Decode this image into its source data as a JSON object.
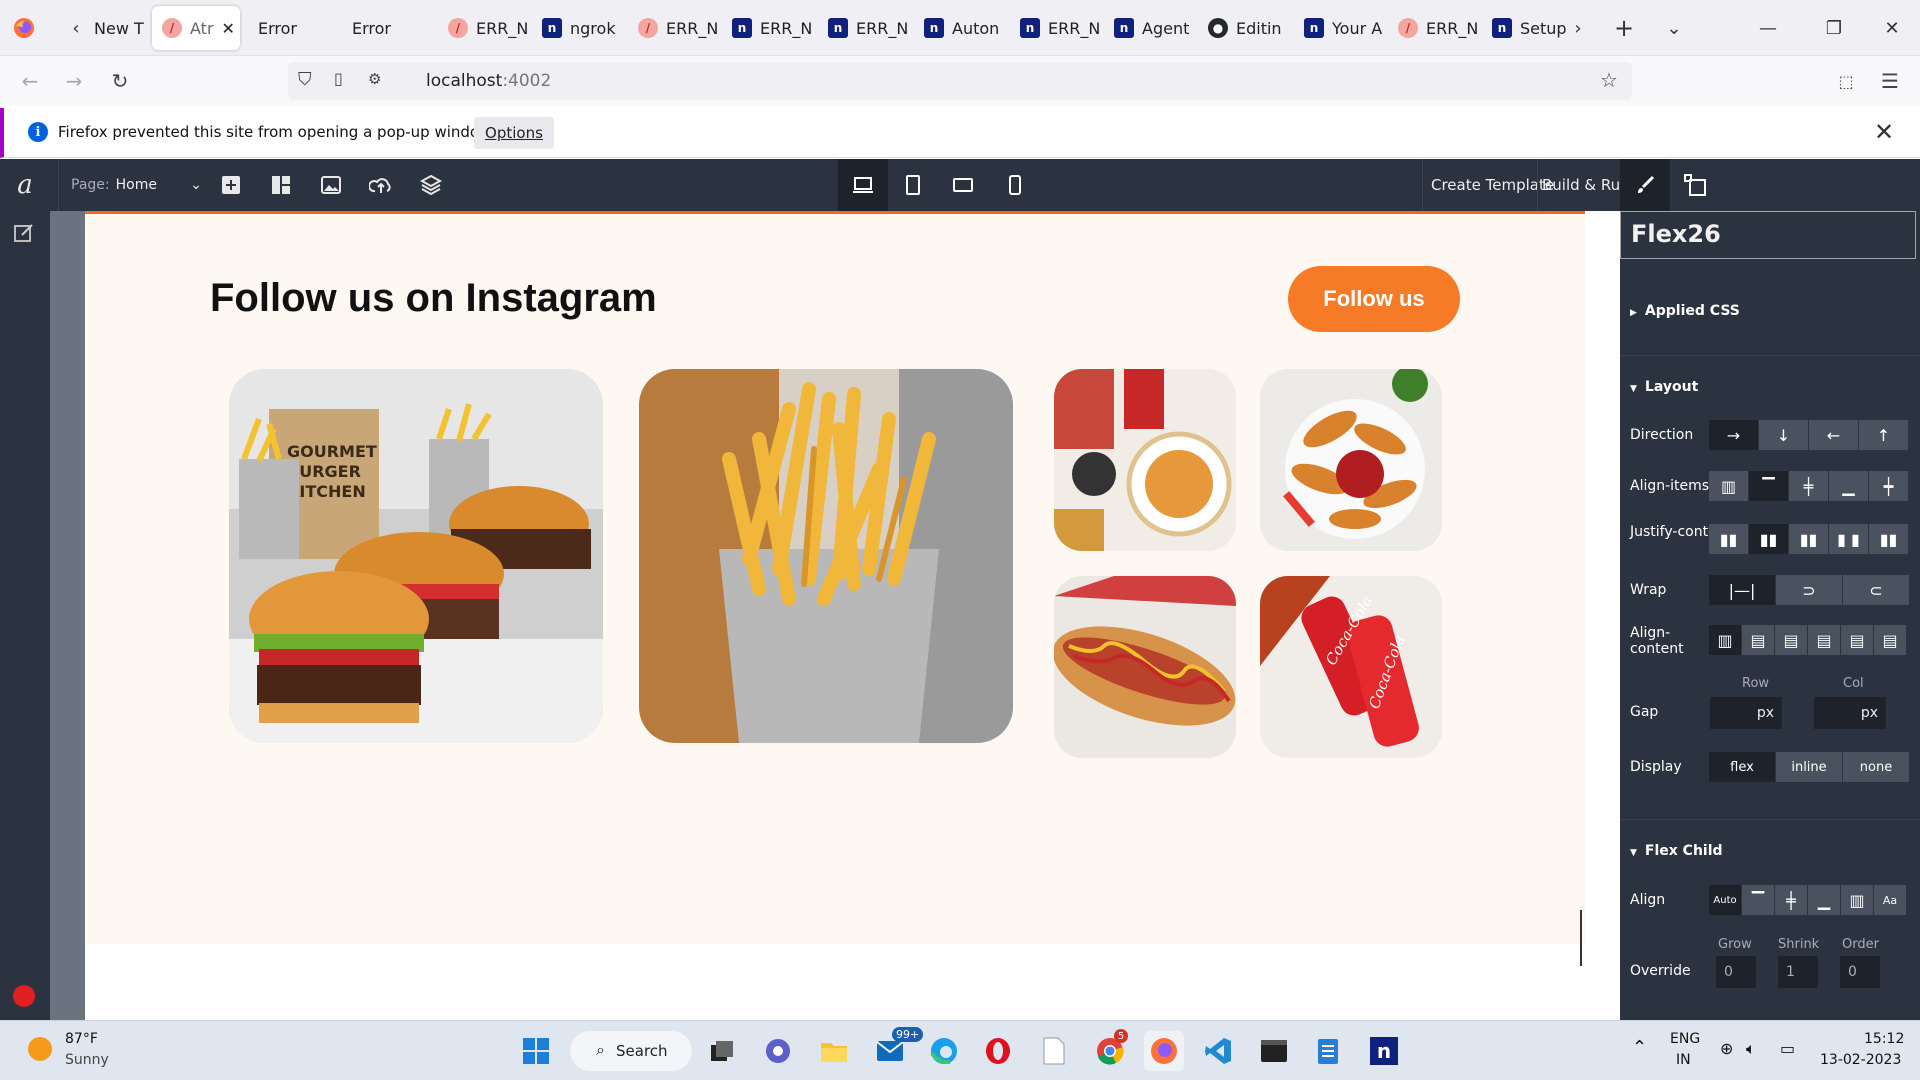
{
  "browser": {
    "tabs": [
      {
        "label": "New T",
        "icon": "firefox-new-tab-icon"
      },
      {
        "label": "Atr",
        "icon": "atri-icon",
        "active": true
      },
      {
        "label": "Error",
        "icon": "none"
      },
      {
        "label": "Error",
        "icon": "none"
      },
      {
        "label": "ERR_N",
        "icon": "atri-icon"
      },
      {
        "label": "ngrok",
        "icon": "n-icon"
      },
      {
        "label": "ERR_N",
        "icon": "atri-icon"
      },
      {
        "label": "ERR_N",
        "icon": "n-icon"
      },
      {
        "label": "ERR_N",
        "icon": "n-icon"
      },
      {
        "label": "Auton",
        "icon": "n-icon"
      },
      {
        "label": "ERR_N",
        "icon": "n-icon"
      },
      {
        "label": "Agent",
        "icon": "n-icon"
      },
      {
        "label": "Editin",
        "icon": "github-icon"
      },
      {
        "label": "Your A",
        "icon": "n-icon"
      },
      {
        "label": "ERR_N",
        "icon": "atri-icon"
      },
      {
        "label": "Setup",
        "icon": "n-icon"
      }
    ],
    "url_host": "localhost",
    "url_port": ":4002",
    "notification": {
      "message": "Firefox prevented this site from opening a pop-up window.",
      "options_label": "Options"
    }
  },
  "editor": {
    "page_label": "Page:",
    "page_value": "Home",
    "create_template": "Create Template",
    "build_run": "Build & Run"
  },
  "canvas": {
    "heading": "Follow us on Instagram",
    "follow_button": "Follow us",
    "images": [
      {
        "name": "burgers-photo",
        "desc": "Gourmet Burger Kitchen"
      },
      {
        "name": "fries-photo"
      },
      {
        "name": "burger-cola-photo"
      },
      {
        "name": "potato-wedges-photo"
      },
      {
        "name": "hotdog-photo"
      },
      {
        "name": "coca-cola-cans-photo",
        "text": "Coca-Cola"
      }
    ]
  },
  "panel": {
    "title": "Flex26",
    "applied_css": "Applied CSS",
    "layout": "Layout",
    "direction": "Direction",
    "align_items": "Align-items",
    "justify_content": "Justify-content",
    "wrap": "Wrap",
    "align_content": "Align-content",
    "gap": "Gap",
    "row": "Row",
    "col": "Col",
    "px": "px",
    "display": "Display",
    "display_options": [
      "flex",
      "inline",
      "none"
    ],
    "flex_child": "Flex Child",
    "align": "Align",
    "auto": "Auto",
    "override": "Override",
    "grow": "Grow",
    "shrink": "Shrink",
    "order": "Order",
    "grow_value": "0",
    "shrink_value": "1",
    "order_value": "0"
  },
  "taskbar": {
    "weather_temp": "87°F",
    "weather_desc": "Sunny",
    "search": "Search",
    "mail_badge": "99+",
    "chrome_badge": "5",
    "lang": "ENG",
    "region": "IN",
    "time": "15:12",
    "date": "13-02-2023"
  }
}
